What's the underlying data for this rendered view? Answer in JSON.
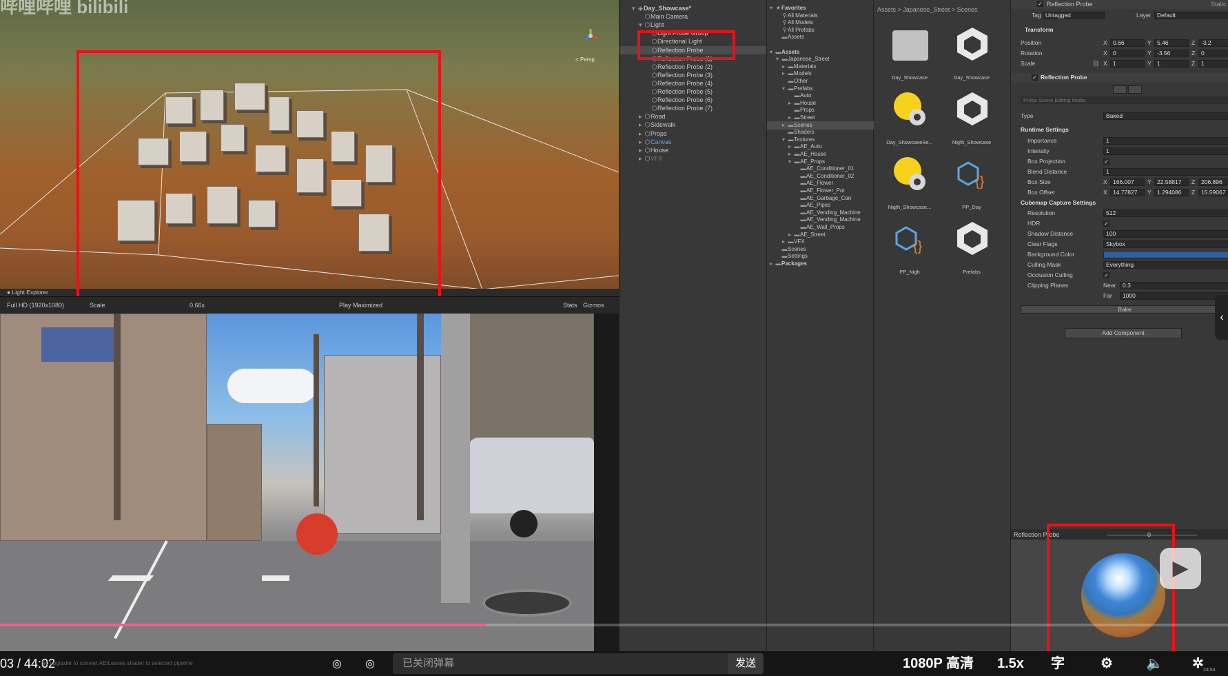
{
  "scene_view": {
    "watermark": "哔哩哔哩 bilibili",
    "persp_label": "< Persp",
    "light_explorer_label": "Light Explorer"
  },
  "game_view_bar": {
    "resolution": "Full HD (1920x1080)",
    "scale_label": "Scale",
    "scale_value": "0.66x",
    "play_mode": "Play Maximized",
    "stats": "Stats",
    "gizmos": "Gizmos"
  },
  "hierarchy": {
    "items": [
      {
        "label": "Day_Showcase*",
        "level": 0,
        "expanded": true,
        "icon": "unity-scene-icon"
      },
      {
        "label": "Main Camera",
        "level": 1,
        "icon": "gameobject-icon"
      },
      {
        "label": "Light",
        "level": 1,
        "expanded": true,
        "icon": "gameobject-icon"
      },
      {
        "label": "Light Probe Group",
        "level": 2,
        "icon": "gameobject-icon"
      },
      {
        "label": "Directional Light",
        "level": 2,
        "icon": "gameobject-icon"
      },
      {
        "label": "Reflection Probe",
        "level": 2,
        "icon": "gameobject-icon",
        "selected": true
      },
      {
        "label": "Reflection Probe (1)",
        "level": 2,
        "icon": "gameobject-icon"
      },
      {
        "label": "Reflection Probe (2)",
        "level": 2,
        "icon": "gameobject-icon"
      },
      {
        "label": "Reflection Probe (3)",
        "level": 2,
        "icon": "gameobject-icon"
      },
      {
        "label": "Reflection Probe (4)",
        "level": 2,
        "icon": "gameobject-icon"
      },
      {
        "label": "Reflection Probe (5)",
        "level": 2,
        "icon": "gameobject-icon"
      },
      {
        "label": "Reflection Probe (6)",
        "level": 2,
        "icon": "gameobject-icon"
      },
      {
        "label": "Reflection Probe (7)",
        "level": 2,
        "icon": "gameobject-icon"
      },
      {
        "label": "Road",
        "level": 1,
        "collapsed": true,
        "icon": "gameobject-icon"
      },
      {
        "label": "Sidewalk",
        "level": 1,
        "collapsed": true,
        "icon": "gameobject-icon"
      },
      {
        "label": "Props",
        "level": 1,
        "collapsed": true,
        "icon": "gameobject-icon"
      },
      {
        "label": "Canvas",
        "level": 1,
        "collapsed": true,
        "icon": "gameobject-icon",
        "highlight": true
      },
      {
        "label": "House",
        "level": 1,
        "collapsed": true,
        "icon": "gameobject-icon"
      },
      {
        "label": "VFX",
        "level": 1,
        "collapsed": true,
        "icon": "gameobject-icon",
        "dim": true
      }
    ]
  },
  "project": {
    "tree": [
      {
        "label": "Favorites",
        "level": 0,
        "expanded": true,
        "icon": "star-icon"
      },
      {
        "label": "All Materials",
        "level": 1,
        "icon": "search-icon"
      },
      {
        "label": "All Models",
        "level": 1,
        "icon": "search-icon"
      },
      {
        "label": "All Prefabs",
        "level": 1,
        "icon": "search-icon"
      },
      {
        "label": "Assets",
        "level": 1,
        "icon": "folder-icon"
      },
      {
        "label": "",
        "level": 0,
        "icon": ""
      },
      {
        "label": "Assets",
        "level": 0,
        "expanded": true,
        "icon": "folder-icon"
      },
      {
        "label": "Japanese_Street",
        "level": 1,
        "expanded": true,
        "icon": "folder-icon"
      },
      {
        "label": "Materials",
        "level": 2,
        "collapsed": true,
        "icon": "folder-icon"
      },
      {
        "label": "Models",
        "level": 2,
        "collapsed": true,
        "icon": "folder-icon"
      },
      {
        "label": "Other",
        "level": 2,
        "icon": "folder-icon"
      },
      {
        "label": "Prefabs",
        "level": 2,
        "expanded": true,
        "icon": "folder-icon"
      },
      {
        "label": "Auto",
        "level": 3,
        "icon": "folder-icon"
      },
      {
        "label": "House",
        "level": 3,
        "collapsed": true,
        "icon": "folder-icon"
      },
      {
        "label": "Props",
        "level": 3,
        "icon": "folder-icon"
      },
      {
        "label": "Street",
        "level": 3,
        "collapsed": true,
        "icon": "folder-icon"
      },
      {
        "label": "Scenes",
        "level": 2,
        "collapsed": true,
        "icon": "folder-icon",
        "selected": true
      },
      {
        "label": "Shaders",
        "level": 2,
        "icon": "folder-icon"
      },
      {
        "label": "Textures",
        "level": 2,
        "expanded": true,
        "icon": "folder-icon"
      },
      {
        "label": "AE_Auto",
        "level": 3,
        "collapsed": true,
        "icon": "folder-icon"
      },
      {
        "label": "AE_House",
        "level": 3,
        "collapsed": true,
        "icon": "folder-icon"
      },
      {
        "label": "AE_Props",
        "level": 3,
        "expanded": true,
        "icon": "folder-icon"
      },
      {
        "label": "AE_Conditioner_01",
        "level": 4,
        "icon": "folder-icon"
      },
      {
        "label": "AE_Conditioner_02",
        "level": 4,
        "icon": "folder-icon"
      },
      {
        "label": "AE_Flower",
        "level": 4,
        "icon": "folder-icon"
      },
      {
        "label": "AE_Flower_Pot",
        "level": 4,
        "icon": "folder-icon"
      },
      {
        "label": "AE_Garbage_Can",
        "level": 4,
        "icon": "folder-icon"
      },
      {
        "label": "AE_Pipes",
        "level": 4,
        "icon": "folder-icon"
      },
      {
        "label": "AE_Vending_Machine",
        "level": 4,
        "icon": "folder-icon"
      },
      {
        "label": "AE_Vending_Machine",
        "level": 4,
        "icon": "folder-icon"
      },
      {
        "label": "AE_Wall_Props",
        "level": 4,
        "icon": "folder-icon"
      },
      {
        "label": "AE_Street",
        "level": 3,
        "collapsed": true,
        "icon": "folder-icon"
      },
      {
        "label": "VFX",
        "level": 2,
        "collapsed": true,
        "icon": "folder-icon"
      },
      {
        "label": "Scenes",
        "level": 1,
        "icon": "folder-icon"
      },
      {
        "label": "Settings",
        "level": 1,
        "icon": "folder-icon"
      },
      {
        "label": "Packages",
        "level": 0,
        "collapsed": true,
        "icon": "folder-icon"
      }
    ],
    "breadcrumb": [
      "Assets",
      "Japanese_Street",
      "Scenes"
    ],
    "assets": [
      {
        "label": "Day_Showcase",
        "icon": "folder-icon"
      },
      {
        "label": "Day_Showcase",
        "icon": "unity-scene-icon"
      },
      {
        "label": "Day_ShowcaseSe...",
        "icon": "lighting-settings-icon"
      },
      {
        "label": "Nigth_Showcase",
        "icon": "unity-scene-icon"
      },
      {
        "label": "Nigth_Showcase...",
        "icon": "lighting-settings-icon"
      },
      {
        "label": "PP_Day",
        "icon": "volume-profile-icon"
      },
      {
        "label": "PP_Nigh",
        "icon": "volume-profile-icon"
      },
      {
        "label": "Prefabs",
        "icon": "unity-scene-icon"
      }
    ]
  },
  "inspector": {
    "object_name": "Reflection Probe",
    "static_label": "Static",
    "tag_label": "Tag",
    "tag_value": "Untagged",
    "layer_label": "Layer",
    "layer_value": "Default",
    "transform": {
      "title": "Transform",
      "position": {
        "label": "Position",
        "x": "0.66",
        "y": "5.46",
        "z": "-3.2"
      },
      "rotation": {
        "label": "Rotation",
        "x": "0",
        "y": "-3.56",
        "z": "0"
      },
      "scale": {
        "label": "Scale",
        "x": "1",
        "y": "1",
        "z": "1"
      }
    },
    "probe": {
      "title": "Reflection Probe",
      "editing_mode": "Probe Scene Editing Mode:",
      "type_label": "Type",
      "type_value": "Baked",
      "runtime_title": "Runtime Settings",
      "importance_label": "Importance",
      "importance_value": "1",
      "intensity_label": "Intensity",
      "intensity_value": "1",
      "box_projection_label": "Box Projection",
      "box_projection_checked": true,
      "blend_distance_label": "Blend Distance",
      "blend_distance_value": "1",
      "box_size": {
        "label": "Box Size",
        "x": "166.007",
        "y": "22.58817",
        "z": "206.896"
      },
      "box_offset": {
        "label": "Box Offset",
        "x": "14.77827",
        "y": "1.294086",
        "z": "15.59067"
      },
      "cubemap_title": "Cubemap Capture Settings",
      "resolution_label": "Resolution",
      "resolution_value": "512",
      "hdr_label": "HDR",
      "hdr_checked": true,
      "shadow_label": "Shadow Distance",
      "shadow_value": "100",
      "clear_flags_label": "Clear Flags",
      "clear_flags_value": "Skybox",
      "bg_color_label": "Background Color",
      "bg_color": "#2f5fa0",
      "culling_label": "Culling Mask",
      "culling_value": "Everything",
      "occlusion_label": "Occlusion Culling",
      "occlusion_checked": true,
      "clipping_label": "Clipping Planes",
      "near_label": "Near",
      "near_value": "0.3",
      "far_label": "Far",
      "far_value": "1000",
      "bake_label": "Bake"
    },
    "add_component": "Add Component",
    "preview": {
      "title": "Reflection Probe",
      "mip_value": "0"
    }
  },
  "console_message": "No upgrader to convert AE/Leaves shader to selected pipeline",
  "player": {
    "time": "03 / 44:02",
    "danmaku_placeholder": "已关闭弹幕",
    "send": "发送",
    "quality": "1080P 高清",
    "speed": "1.5x",
    "subtitle": "字",
    "progress": 0.396,
    "clock": "23:54"
  },
  "colors": {
    "highlight_red": "#e5141a",
    "progress_pink": "#f25d8e",
    "unity_panel": "#383838",
    "selection": "#4d4d4d",
    "link_blue": "#5ea6ff"
  }
}
